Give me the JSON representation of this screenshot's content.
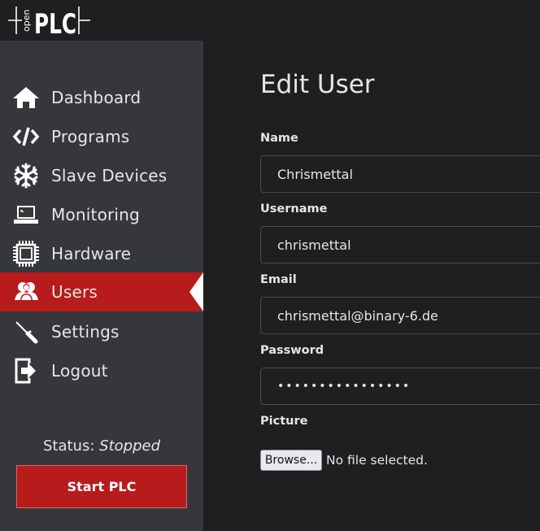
{
  "brand": {
    "logo_small_text": "open",
    "logo_text": "PLC"
  },
  "sidebar": {
    "items": [
      {
        "label": "Dashboard",
        "icon": "home-icon"
      },
      {
        "label": "Programs",
        "icon": "code-icon"
      },
      {
        "label": "Slave Devices",
        "icon": "snowflake-icon"
      },
      {
        "label": "Monitoring",
        "icon": "laptop-icon"
      },
      {
        "label": "Hardware",
        "icon": "chip-icon"
      },
      {
        "label": "Users",
        "icon": "users-icon",
        "active": true
      },
      {
        "label": "Settings",
        "icon": "wrench-icon"
      },
      {
        "label": "Logout",
        "icon": "logout-icon"
      }
    ],
    "status_label": "Status:",
    "status_value": "Stopped",
    "start_button": "Start PLC"
  },
  "main": {
    "title": "Edit User",
    "fields": {
      "name_label": "Name",
      "name_value": "Chrismettal",
      "username_label": "Username",
      "username_value": "chrismettal",
      "email_label": "Email",
      "email_value": "chrismettal@binary-6.de",
      "password_label": "Password",
      "password_value": "••••••••••••••••",
      "picture_label": "Picture",
      "browse_button": "Browse...",
      "file_status": "No file selected."
    }
  },
  "colors": {
    "accent": "#b71b1b",
    "sidebar_bg": "#35373a",
    "page_bg": "#1f1f21",
    "text": "#e6e6e6"
  }
}
